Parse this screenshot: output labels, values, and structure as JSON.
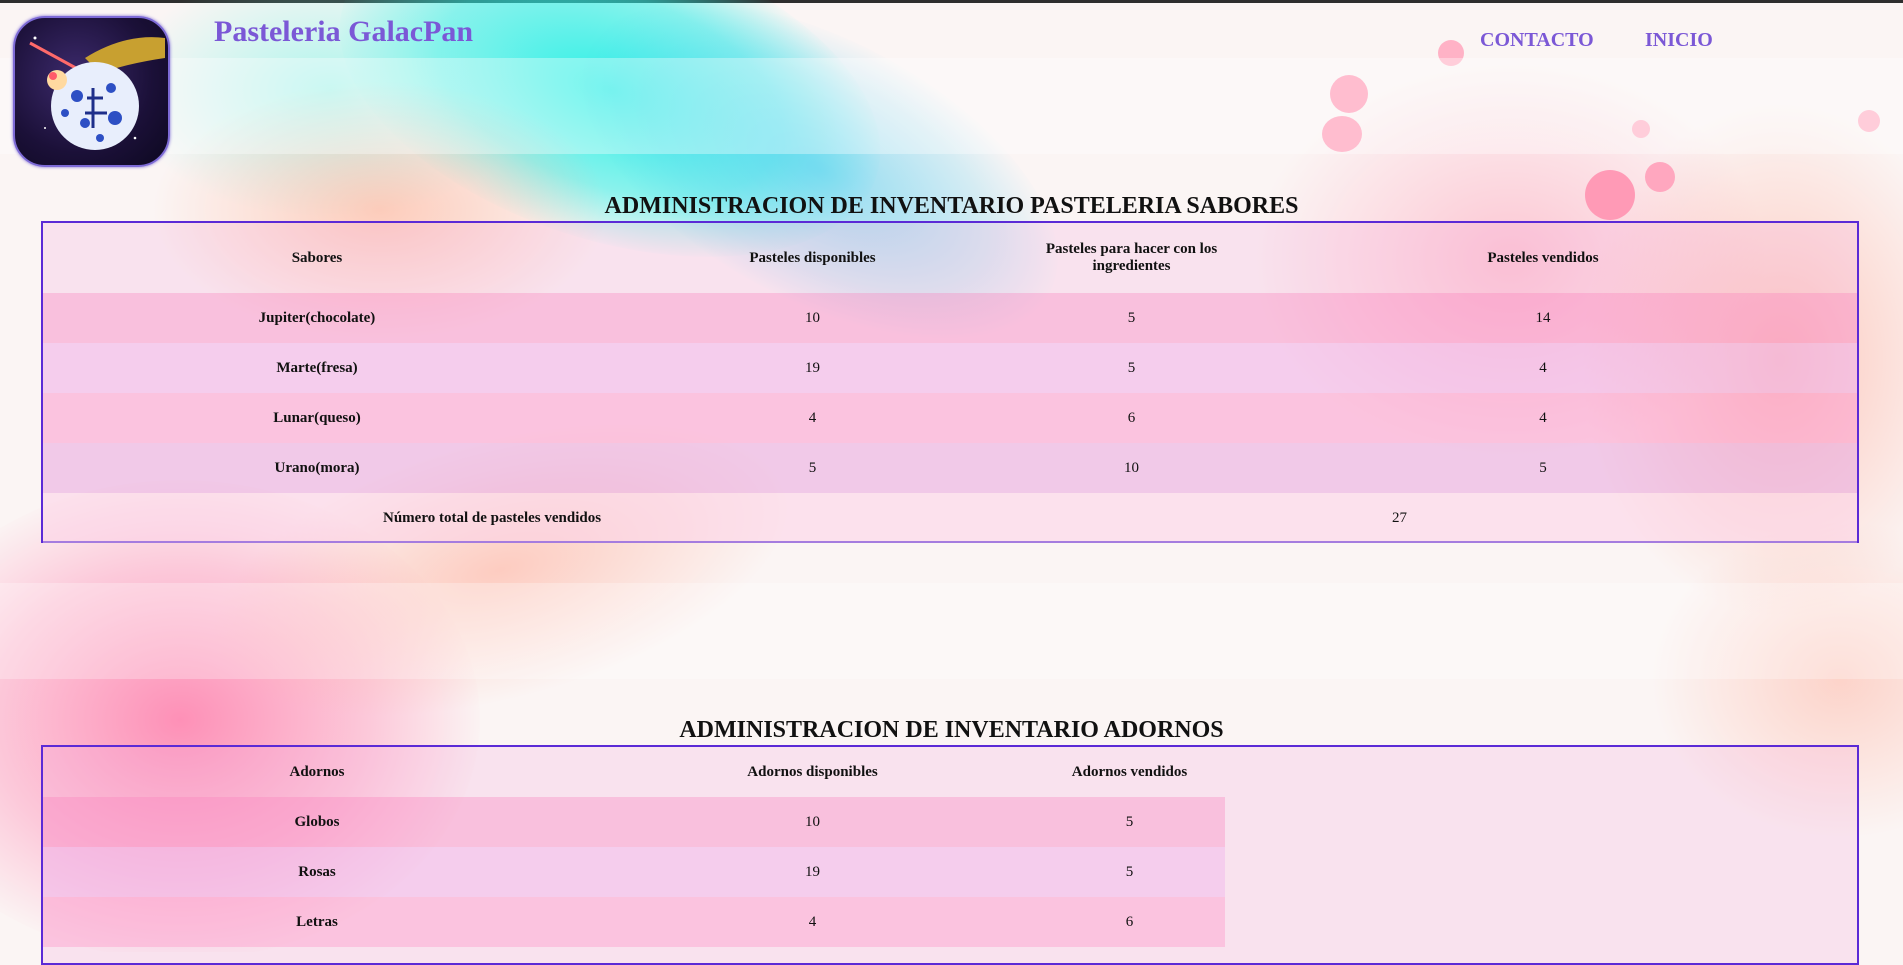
{
  "header": {
    "brand": "Pasteleria GalacPan",
    "nav": {
      "contact": "CONTACTO",
      "home": "INICIO"
    },
    "brand_color": "#7b58d6"
  },
  "flavors": {
    "title": "ADMINISTRACION DE INVENTARIO PASTELERIA SABORES",
    "headers": [
      "Sabores",
      "Pasteles disponibles",
      "Pasteles para hacer con los ingredientes",
      "Pasteles vendidos"
    ],
    "rows": [
      [
        "Jupiter(chocolate)",
        "10",
        "5",
        "14"
      ],
      [
        "Marte(fresa)",
        "19",
        "5",
        "4"
      ],
      [
        "Lunar(queso)",
        "4",
        "6",
        "4"
      ],
      [
        "Urano(mora)",
        "5",
        "10",
        "5"
      ]
    ],
    "total_label": "Número total de pasteles vendidos",
    "total_value": "27"
  },
  "decorations": {
    "title": "ADMINISTRACION DE INVENTARIO ADORNOS",
    "headers": [
      "Adornos",
      "Adornos disponibles",
      "Adornos vendidos"
    ],
    "rows": [
      [
        "Globos",
        "10",
        "5"
      ],
      [
        "Rosas",
        "19",
        "5"
      ],
      [
        "Letras",
        "4",
        "6"
      ]
    ]
  },
  "colors": {
    "table_border": "#5b2ad6",
    "accent_cyan": "#2ef0e4",
    "accent_pink": "#ff8fb8"
  }
}
